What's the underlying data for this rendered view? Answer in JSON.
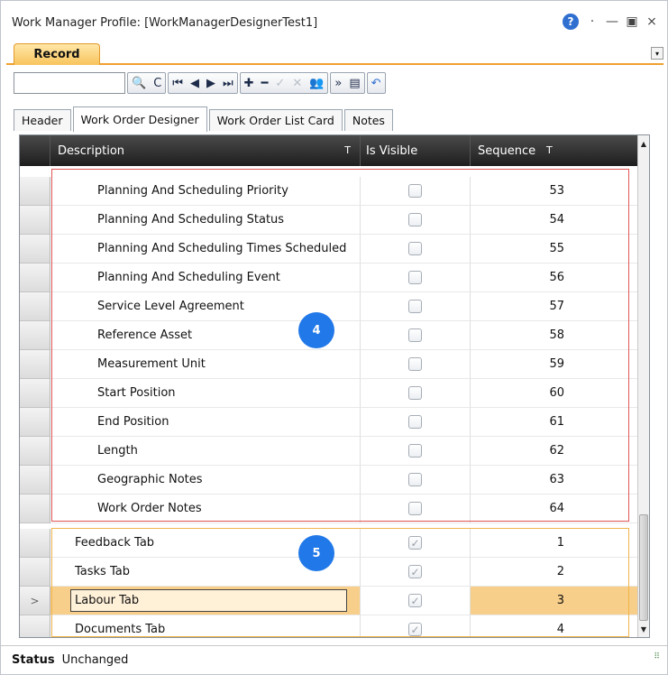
{
  "window": {
    "title": "Work Manager Profile: [WorkManagerDesignerTest1]",
    "help_glyph": "?",
    "dot_glyph": "·",
    "minimize_glyph": "—",
    "restore_glyph": "▣",
    "close_glyph": "⨯"
  },
  "ribbon": {
    "tab_label": "Record",
    "menu_glyph": "▾"
  },
  "toolbar": {
    "search_value": "",
    "search_glyph": "🔍",
    "refresh_glyph": "C",
    "first_glyph": "⏮",
    "prev_glyph": "◀",
    "next_glyph": "▶",
    "last_glyph": "⏭",
    "add_glyph": "✚",
    "remove_glyph": "━",
    "accept_glyph": "✓",
    "cancel_glyph": "✕",
    "people_glyph": "👥",
    "more_glyph": "»",
    "list_glyph": "▤",
    "undo_glyph": "↶"
  },
  "tabs": [
    {
      "label": "Header",
      "active": false
    },
    {
      "label": "Work Order Designer",
      "active": true
    },
    {
      "label": "Work Order List Card",
      "active": false
    },
    {
      "label": "Notes",
      "active": false
    }
  ],
  "grid": {
    "columns": {
      "description": "Description",
      "is_visible": "Is Visible",
      "sequence": "Sequence"
    },
    "filter_glyph": "T",
    "rows": [
      {
        "description": "Planning And Scheduling Priority",
        "visible": false,
        "sequence": "53",
        "indent": true
      },
      {
        "description": "Planning And Scheduling Status",
        "visible": false,
        "sequence": "54",
        "indent": true
      },
      {
        "description": "Planning And Scheduling Times Scheduled",
        "visible": false,
        "sequence": "55",
        "indent": true
      },
      {
        "description": "Planning And Scheduling Event",
        "visible": false,
        "sequence": "56",
        "indent": true
      },
      {
        "description": "Service Level Agreement",
        "visible": false,
        "sequence": "57",
        "indent": true
      },
      {
        "description": "Reference Asset",
        "visible": false,
        "sequence": "58",
        "indent": true
      },
      {
        "description": "Measurement Unit",
        "visible": false,
        "sequence": "59",
        "indent": true
      },
      {
        "description": "Start Position",
        "visible": false,
        "sequence": "60",
        "indent": true
      },
      {
        "description": "End Position",
        "visible": false,
        "sequence": "61",
        "indent": true
      },
      {
        "description": "Length",
        "visible": false,
        "sequence": "62",
        "indent": true
      },
      {
        "description": "Geographic Notes",
        "visible": false,
        "sequence": "63",
        "indent": true
      },
      {
        "description": "Work Order Notes",
        "visible": false,
        "sequence": "64",
        "indent": true
      },
      {
        "description": "Feedback Tab",
        "visible": true,
        "sequence": "1",
        "indent": false
      },
      {
        "description": "Tasks Tab",
        "visible": true,
        "sequence": "2",
        "indent": false
      },
      {
        "description": "Labour Tab",
        "visible": true,
        "sequence": "3",
        "indent": false,
        "selected": true
      },
      {
        "description": "Documents Tab",
        "visible": true,
        "sequence": "4",
        "indent": false
      }
    ],
    "current_row_glyph": ">"
  },
  "annotations": {
    "badge4": "4",
    "badge5": "5"
  },
  "status": {
    "label": "Status",
    "value": "Unchanged"
  },
  "colors": {
    "accent_orange": "#f0a030",
    "selected_row": "#f8cf8a",
    "red_box": "#e25555",
    "yellow_box": "#f0b44a",
    "badge_blue": "#2178e8"
  }
}
